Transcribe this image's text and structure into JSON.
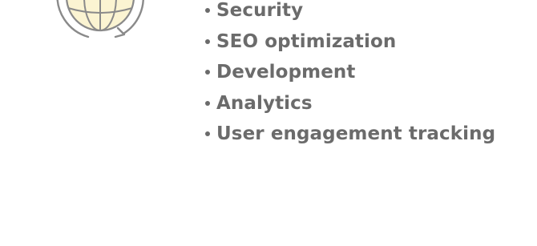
{
  "icon": {
    "name": "globe-sync-icon",
    "fill_color": "#fbf4d2",
    "stroke_color": "#8a8a8a"
  },
  "features": {
    "text_color": "#6b6b6b",
    "items": [
      {
        "label": "Security"
      },
      {
        "label": "SEO optimization"
      },
      {
        "label": "Development"
      },
      {
        "label": "Analytics"
      },
      {
        "label": "User engagement tracking"
      }
    ]
  }
}
